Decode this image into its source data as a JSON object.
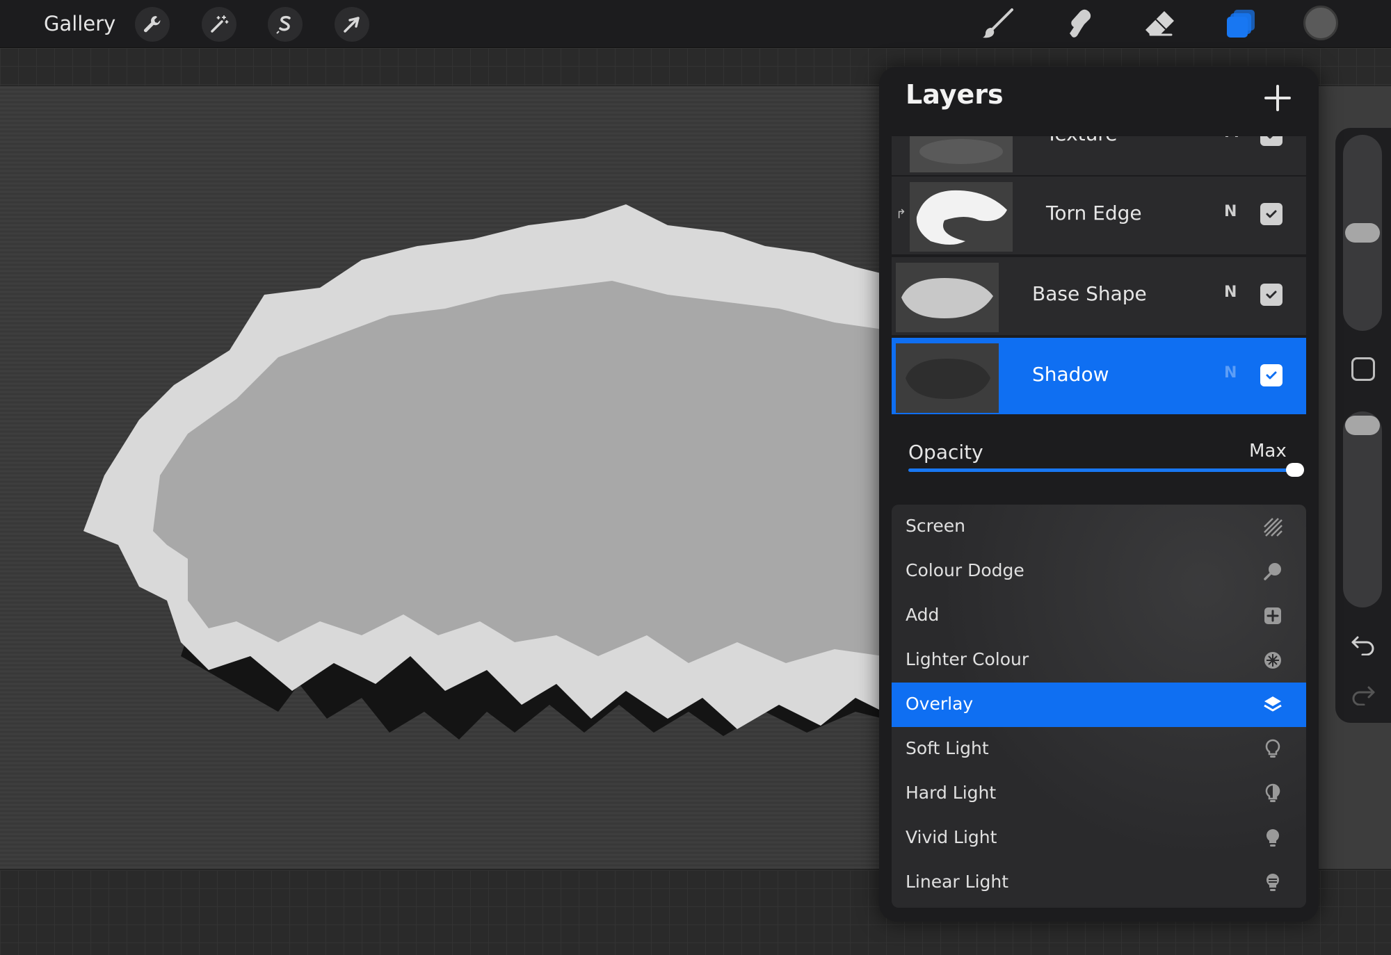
{
  "toolbar": {
    "gallery_label": "Gallery",
    "left_tools": [
      "wrench-icon",
      "magic-wand-icon",
      "selection-s-icon",
      "transform-arrow-icon"
    ],
    "right_tools": [
      "brush-icon",
      "smudge-icon",
      "eraser-icon",
      "layers-icon"
    ],
    "active_colour": "#5a5a5a",
    "accent_color": "#1877f2"
  },
  "layers_panel": {
    "title": "Layers",
    "add_icon": "plus-icon",
    "layers": [
      {
        "name": "Texture",
        "mode": "M",
        "visible": true,
        "selected": false
      },
      {
        "name": "Torn Edge",
        "mode": "N",
        "visible": true,
        "selected": false
      },
      {
        "name": "Base Shape",
        "mode": "N",
        "visible": true,
        "selected": false
      },
      {
        "name": "Shadow",
        "mode": "N",
        "visible": true,
        "selected": true
      }
    ],
    "opacity": {
      "label": "Opacity",
      "value_label": "Max",
      "fraction": 1.0
    }
  },
  "blend_modes": [
    {
      "label": "Screen",
      "icon": "hatch-icon",
      "selected": false
    },
    {
      "label": "Colour Dodge",
      "icon": "magnifier-icon",
      "selected": false
    },
    {
      "label": "Add",
      "icon": "plus-square-icon",
      "selected": false
    },
    {
      "label": "Lighter Colour",
      "icon": "sparkle-icon",
      "selected": false
    },
    {
      "label": "Overlay",
      "icon": "stack-icon",
      "selected": true
    },
    {
      "label": "Soft Light",
      "icon": "bulb-outline-icon",
      "selected": false
    },
    {
      "label": "Hard Light",
      "icon": "bulb-half-icon",
      "selected": false
    },
    {
      "label": "Vivid Light",
      "icon": "bulb-filled-icon",
      "selected": false
    },
    {
      "label": "Linear Light",
      "icon": "bulb-lines-icon",
      "selected": false
    }
  ],
  "sidebar": {
    "brush_size_level": 0.45,
    "brush_opacity_level": 0.0
  }
}
